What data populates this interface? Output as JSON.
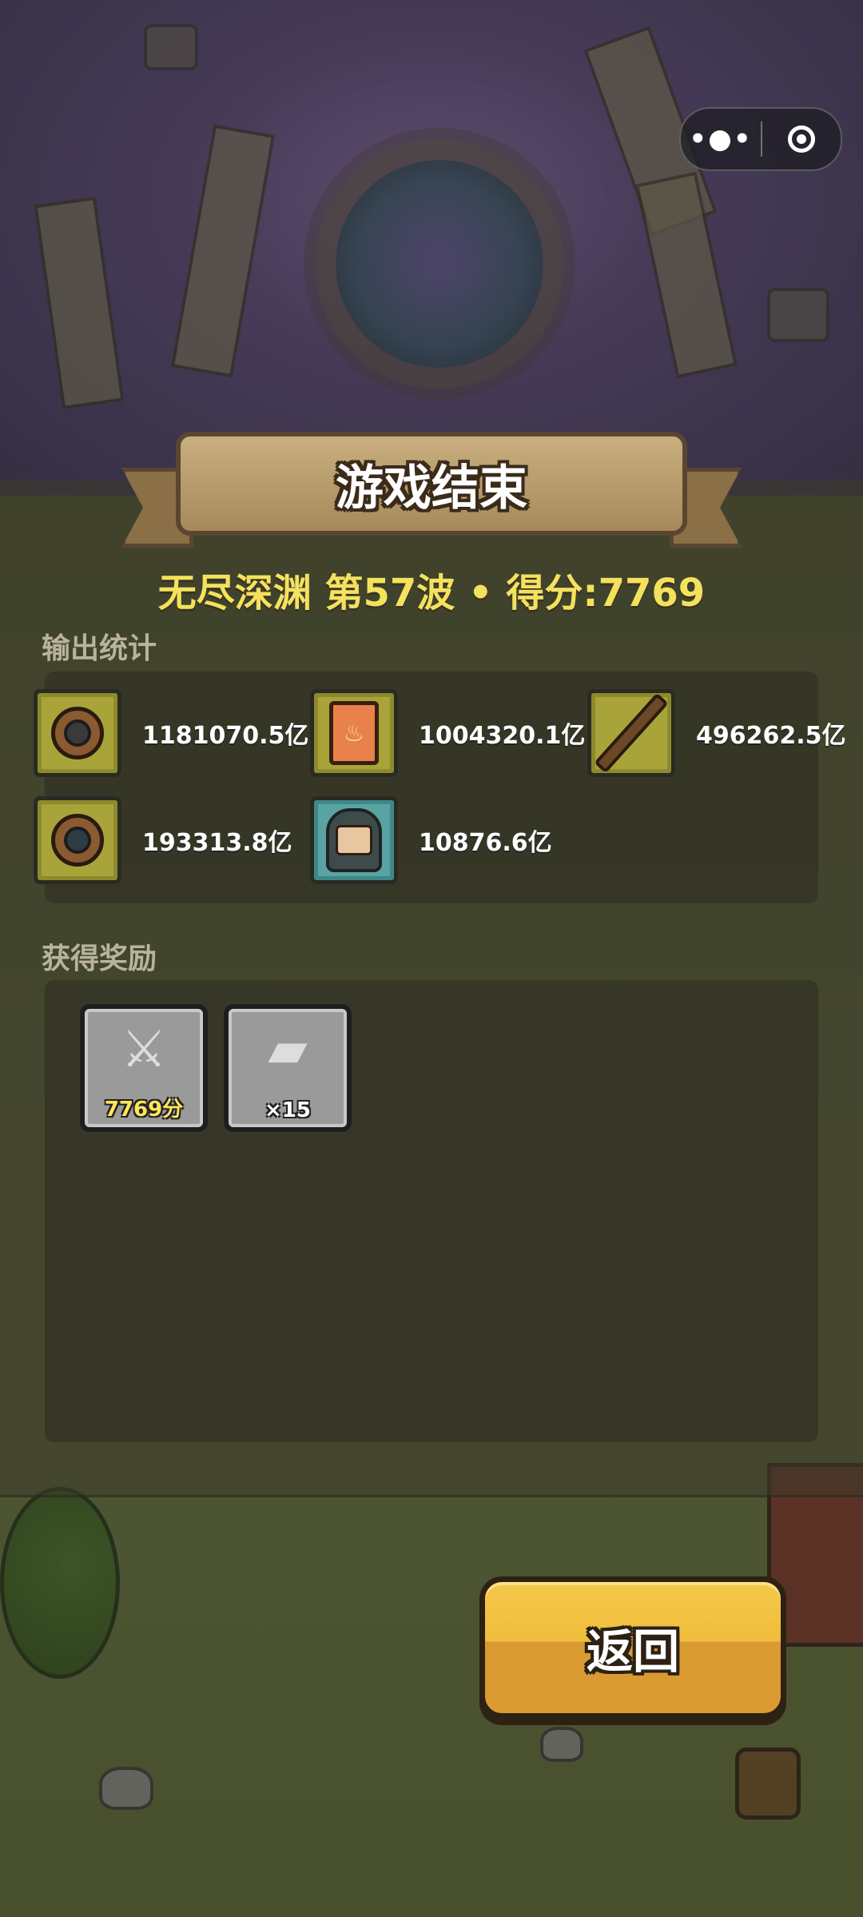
{
  "menu_capsule": {
    "more_icon": "more-dots-icon",
    "close_icon": "target-circle-icon"
  },
  "title": "游戏结束",
  "mode_line": "无尽深渊 第57波 • 得分:7769",
  "output_stats": {
    "label": "输出统计",
    "items": [
      {
        "icon": "round-shield-icon",
        "value": "1181070.5亿",
        "tile_color": "olive"
      },
      {
        "icon": "fire-book-icon",
        "value": "1004320.1亿",
        "tile_color": "olive"
      },
      {
        "icon": "wooden-staff-icon",
        "value": "496262.5亿",
        "tile_color": "olive"
      },
      {
        "icon": "iron-shield-icon",
        "value": "193313.8亿",
        "tile_color": "olive"
      },
      {
        "icon": "knight-hero-icon",
        "value": "10876.6亿",
        "tile_color": "teal"
      }
    ]
  },
  "rewards": {
    "label": "获得奖励",
    "items": [
      {
        "icon": "crossed-swords-icon",
        "quantity": "7769分"
      },
      {
        "icon": "ticket-icon",
        "quantity": "×15"
      }
    ]
  },
  "back_button": {
    "label": "返回",
    "color": "#f0bd3c"
  }
}
